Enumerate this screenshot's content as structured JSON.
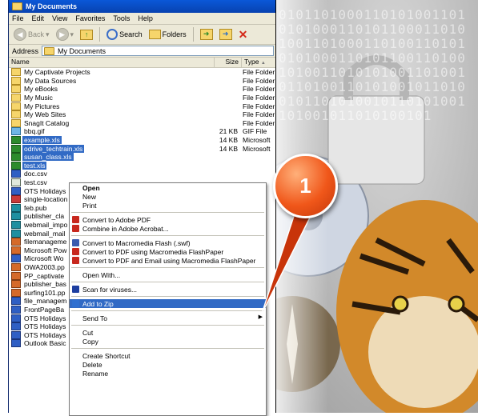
{
  "window": {
    "title": "My Documents",
    "menu": [
      "File",
      "Edit",
      "View",
      "Favorites",
      "Tools",
      "Help"
    ],
    "toolbar": {
      "back": "Back",
      "search": "Search",
      "folders": "Folders"
    },
    "address": {
      "label": "Address",
      "value": "My Documents"
    },
    "columns": {
      "name": "Name",
      "size": "Size",
      "type": "Type"
    }
  },
  "files": [
    {
      "icon": "folder-icon",
      "cls": "folder",
      "name": "My Captivate Projects",
      "size": "",
      "type": "File Folder",
      "selected": false
    },
    {
      "icon": "folder-icon",
      "cls": "folder",
      "name": "My Data Sources",
      "size": "",
      "type": "File Folder",
      "selected": false
    },
    {
      "icon": "folder-icon",
      "cls": "folder",
      "name": "My eBooks",
      "size": "",
      "type": "File Folder",
      "selected": false
    },
    {
      "icon": "folder-icon",
      "cls": "folder",
      "name": "My Music",
      "size": "",
      "type": "File Folder",
      "selected": false
    },
    {
      "icon": "folder-icon",
      "cls": "folder",
      "name": "My Pictures",
      "size": "",
      "type": "File Folder",
      "selected": false
    },
    {
      "icon": "folder-icon",
      "cls": "folder",
      "name": "My Web Sites",
      "size": "",
      "type": "File Folder",
      "selected": false
    },
    {
      "icon": "folder-icon",
      "cls": "folder",
      "name": "SnagIt Catalog",
      "size": "",
      "type": "File Folder",
      "selected": false
    },
    {
      "icon": "gif-file-icon",
      "cls": "gif",
      "name": "bbq.gif",
      "size": "21 KB",
      "type": "GIF File",
      "selected": false
    },
    {
      "icon": "excel-file-icon",
      "cls": "xls",
      "name": "example.xls",
      "size": "14 KB",
      "type": "Microsoft",
      "selected": true
    },
    {
      "icon": "excel-file-icon",
      "cls": "xls",
      "name": "odrive_techtrain.xls",
      "size": "14 KB",
      "type": "Microsoft",
      "selected": true
    },
    {
      "icon": "excel-file-icon",
      "cls": "xls",
      "name": "susan_class.xls",
      "size": "",
      "type": "",
      "selected": true
    },
    {
      "icon": "excel-file-icon",
      "cls": "xls",
      "name": "test.xls",
      "size": "",
      "type": "",
      "selected": true
    },
    {
      "icon": "word-file-icon",
      "cls": "doc",
      "name": "doc.csv",
      "size": "",
      "type": "",
      "selected": false
    },
    {
      "icon": "csv-file-icon",
      "cls": "csv",
      "name": "test.csv",
      "size": "",
      "type": "",
      "selected": false
    },
    {
      "icon": "word-file-icon",
      "cls": "doc",
      "name": "OTS Holidays",
      "size": "",
      "type": "",
      "selected": false
    },
    {
      "icon": "pdf-file-icon",
      "cls": "pdf",
      "name": "single-location",
      "size": "",
      "type": "",
      "selected": false
    },
    {
      "icon": "publisher-file-icon",
      "cls": "pub",
      "name": "feb.pub",
      "size": "",
      "type": "",
      "selected": false
    },
    {
      "icon": "publisher-file-icon",
      "cls": "pub",
      "name": "publisher_cla",
      "size": "",
      "type": "",
      "selected": false
    },
    {
      "icon": "publisher-file-icon",
      "cls": "pub",
      "name": "webmail_impo",
      "size": "",
      "type": "",
      "selected": false
    },
    {
      "icon": "publisher-file-icon",
      "cls": "pub",
      "name": "webmail_mail",
      "size": "",
      "type": "",
      "selected": false
    },
    {
      "icon": "powerpoint-file-icon",
      "cls": "ppt",
      "name": "filemanageme",
      "size": "",
      "type": "",
      "selected": false
    },
    {
      "icon": "powerpoint-file-icon",
      "cls": "ppt",
      "name": "Microsoft Pow",
      "size": "",
      "type": "",
      "selected": false
    },
    {
      "icon": "word-file-icon",
      "cls": "doc",
      "name": "Microsoft Wo",
      "size": "",
      "type": "",
      "selected": false
    },
    {
      "icon": "powerpoint-file-icon",
      "cls": "ppt",
      "name": "OWA2003.pp",
      "size": "",
      "type": "",
      "selected": false
    },
    {
      "icon": "powerpoint-file-icon",
      "cls": "ppt",
      "name": "PP_captivate",
      "size": "",
      "type": "",
      "selected": false
    },
    {
      "icon": "powerpoint-file-icon",
      "cls": "ppt",
      "name": "publisher_bas",
      "size": "",
      "type": "",
      "selected": false
    },
    {
      "icon": "powerpoint-file-icon",
      "cls": "ppt",
      "name": "surfing101.pp",
      "size": "",
      "type": "",
      "selected": false
    },
    {
      "icon": "word-file-icon",
      "cls": "doc",
      "name": "file_managem",
      "size": "",
      "type": "",
      "selected": false
    },
    {
      "icon": "word-file-icon",
      "cls": "doc",
      "name": "FrontPageBa",
      "size": "",
      "type": "",
      "selected": false
    },
    {
      "icon": "word-file-icon",
      "cls": "doc",
      "name": "OTS Holidays",
      "size": "",
      "type": "",
      "selected": false
    },
    {
      "icon": "word-file-icon",
      "cls": "doc",
      "name": "OTS Holidays",
      "size": "",
      "type": "",
      "selected": false
    },
    {
      "icon": "word-file-icon",
      "cls": "doc",
      "name": "OTS Holidays",
      "size": "",
      "type": "",
      "selected": false
    },
    {
      "icon": "word-file-icon",
      "cls": "doc",
      "name": "Outlook Basic",
      "size": "",
      "type": "",
      "selected": false
    }
  ],
  "context_menu": [
    {
      "kind": "item",
      "label": "Open",
      "bold": true
    },
    {
      "kind": "item",
      "label": "New"
    },
    {
      "kind": "item",
      "label": "Print"
    },
    {
      "kind": "sep"
    },
    {
      "kind": "item",
      "label": "Convert to Adobe PDF",
      "icon": "adobe-pdf-icon",
      "color": "#c8281e"
    },
    {
      "kind": "item",
      "label": "Combine in Adobe Acrobat...",
      "icon": "adobe-acrobat-icon",
      "color": "#c8281e"
    },
    {
      "kind": "sep"
    },
    {
      "kind": "item",
      "label": "Convert to Macromedia Flash (.swf)",
      "icon": "flash-icon",
      "color": "#3a5bb0"
    },
    {
      "kind": "item",
      "label": "Convert to PDF using Macromedia FlashPaper",
      "icon": "flashpaper-icon",
      "color": "#c8281e"
    },
    {
      "kind": "item",
      "label": "Convert to PDF and Email using Macromedia FlashPaper",
      "icon": "flashpaper-email-icon",
      "color": "#c8281e"
    },
    {
      "kind": "sep"
    },
    {
      "kind": "item",
      "label": "Open With..."
    },
    {
      "kind": "sep"
    },
    {
      "kind": "item",
      "label": "Scan for viruses...",
      "icon": "antivirus-shield-icon",
      "color": "#1e3fa0"
    },
    {
      "kind": "sep"
    },
    {
      "kind": "item",
      "label": "Add to Zip",
      "icon": "zip-icon",
      "color": "#2f6fd0",
      "highlight": true
    },
    {
      "kind": "sep"
    },
    {
      "kind": "item",
      "label": "Send To",
      "submenu": true
    },
    {
      "kind": "sep"
    },
    {
      "kind": "item",
      "label": "Cut"
    },
    {
      "kind": "item",
      "label": "Copy"
    },
    {
      "kind": "sep"
    },
    {
      "kind": "item",
      "label": "Create Shortcut"
    },
    {
      "kind": "item",
      "label": "Delete"
    },
    {
      "kind": "item",
      "label": "Rename"
    }
  ],
  "callout": {
    "number": "1",
    "color": "#f0571a"
  },
  "background_digits": "0101101000110101001101010100011010110001101010011010001101001101010101000110101100110100101001101010100110100101101001101010010110100101101010010110101001101001011010100101"
}
